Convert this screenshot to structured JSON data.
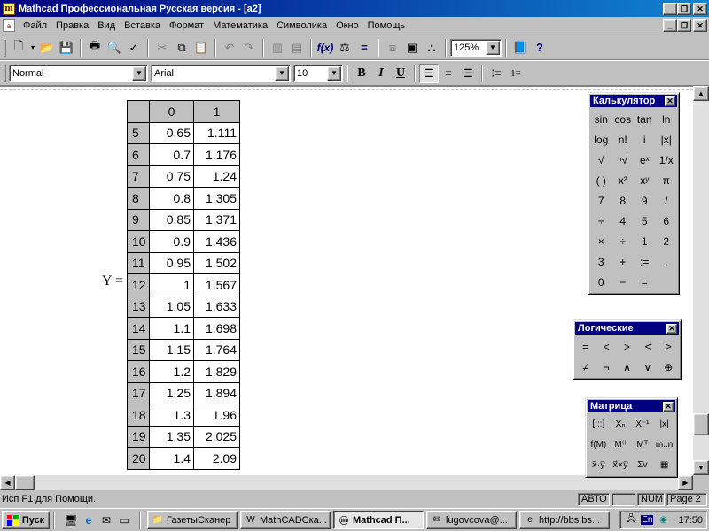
{
  "window": {
    "title": "Mathcad Профессиональная Русская версия - [a2]",
    "app_icon": "mathcad-icon"
  },
  "menu": {
    "items": [
      "Файл",
      "Правка",
      "Вид",
      "Вставка",
      "Формат",
      "Математика",
      "Символика",
      "Окно",
      "Помощь"
    ]
  },
  "toolbar": {
    "zoom": "125%"
  },
  "format_bar": {
    "style": "Normal",
    "font": "Arial",
    "size": "10",
    "bold": "B",
    "italic": "I",
    "underline": "U"
  },
  "worksheet": {
    "variable": "Y =",
    "columns": [
      "0",
      "1"
    ],
    "rows": [
      {
        "index": "5",
        "c0": "0.65",
        "c1": "1.111"
      },
      {
        "index": "6",
        "c0": "0.7",
        "c1": "1.176"
      },
      {
        "index": "7",
        "c0": "0.75",
        "c1": "1.24"
      },
      {
        "index": "8",
        "c0": "0.8",
        "c1": "1.305"
      },
      {
        "index": "9",
        "c0": "0.85",
        "c1": "1.371"
      },
      {
        "index": "10",
        "c0": "0.9",
        "c1": "1.436"
      },
      {
        "index": "11",
        "c0": "0.95",
        "c1": "1.502"
      },
      {
        "index": "12",
        "c0": "1",
        "c1": "1.567"
      },
      {
        "index": "13",
        "c0": "1.05",
        "c1": "1.633"
      },
      {
        "index": "14",
        "c0": "1.1",
        "c1": "1.698"
      },
      {
        "index": "15",
        "c0": "1.15",
        "c1": "1.764"
      },
      {
        "index": "16",
        "c0": "1.2",
        "c1": "1.829"
      },
      {
        "index": "17",
        "c0": "1.25",
        "c1": "1.894"
      },
      {
        "index": "18",
        "c0": "1.3",
        "c1": "1.96"
      },
      {
        "index": "19",
        "c0": "1.35",
        "c1": "2.025"
      },
      {
        "index": "20",
        "c0": "1.4",
        "c1": "2.09"
      }
    ]
  },
  "calculator": {
    "title": "Калькулятор",
    "buttons": [
      "sin",
      "cos",
      "tan",
      "ln",
      "log",
      "n!",
      "i",
      "|x|",
      "√",
      "ⁿ√",
      "eˣ",
      "1/x",
      "( )",
      "x²",
      "xʸ",
      "π",
      "7",
      "8",
      "9",
      "/",
      "÷",
      "4",
      "5",
      "6",
      "×",
      "÷",
      "1",
      "2",
      "3",
      "+",
      ":=",
      ".",
      "0",
      "−",
      "="
    ]
  },
  "logic": {
    "title": "Логические",
    "buttons": [
      "=",
      "<",
      ">",
      "≤",
      "≥",
      "≠",
      "¬",
      "∧",
      "∨",
      "⊕"
    ]
  },
  "matrix_palette": {
    "title": "Матрица",
    "buttons": [
      "[:::]",
      "Xₙ",
      "X⁻¹",
      "|x|",
      "f(M)",
      "M⁽⁾",
      "Mᵀ",
      "m..n",
      "x⃗·y⃗",
      "x⃗×y⃗",
      "Σv",
      "▦"
    ]
  },
  "status": {
    "message": "Исп F1 для Помощи.",
    "mode": "АВТО",
    "blank": "",
    "num": "NUM",
    "page": "Page 2"
  },
  "taskbar": {
    "start": "Пуск",
    "tasks": [
      {
        "label": "ГазетыСканер",
        "icon": "folder-icon",
        "active": false
      },
      {
        "label": "MathCADСка...",
        "icon": "word-icon",
        "active": false
      },
      {
        "label": "Mathcad П...",
        "icon": "mathcad-icon",
        "active": true
      },
      {
        "label": "lugovcova@...",
        "icon": "mail-icon",
        "active": false
      },
      {
        "label": "http://bbs.bs...",
        "icon": "ie-icon",
        "active": false
      }
    ],
    "lang": "En",
    "clock": "17:50"
  }
}
